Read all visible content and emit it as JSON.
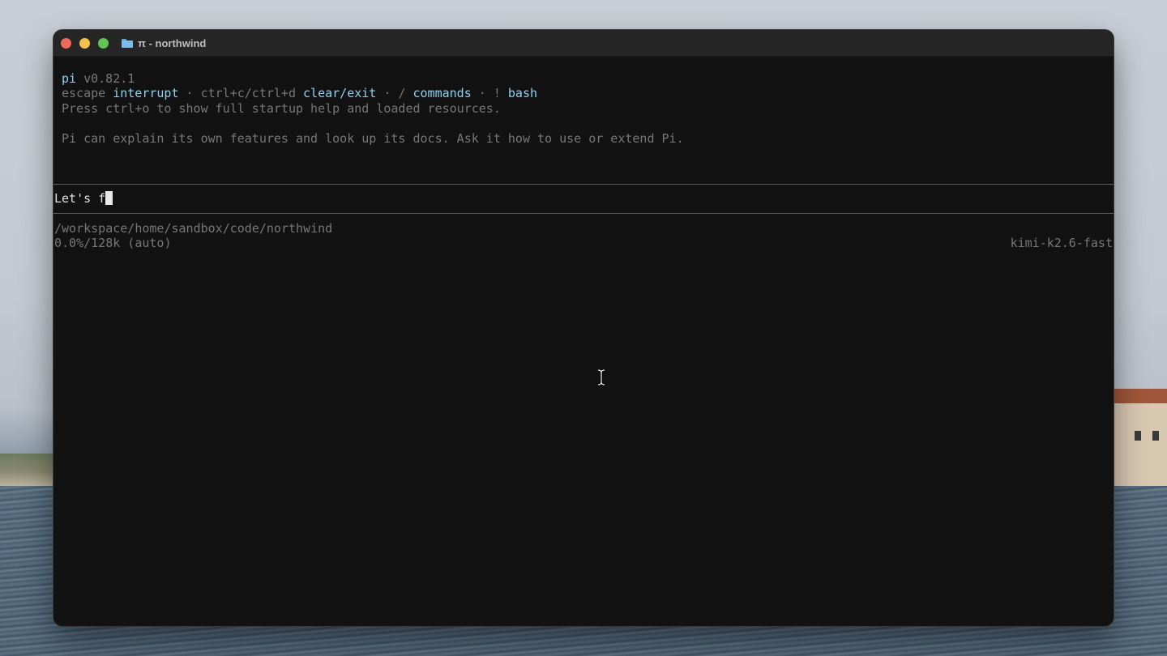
{
  "window": {
    "title": "π - northwind"
  },
  "terminal": {
    "app_name": "pi",
    "version": "v0.82.1",
    "hints": [
      {
        "key": "escape",
        "action": "interrupt"
      },
      {
        "key": "ctrl+c/ctrl+d",
        "action": "clear/exit"
      },
      {
        "key": "/",
        "action": "commands"
      },
      {
        "key": "!",
        "action": "bash"
      }
    ],
    "separator": " · ",
    "startup_hint": "Press ctrl+o to show full startup help and loaded resources.",
    "info_message": "Pi can explain its own features and look up its docs. Ask it how to use or extend Pi.",
    "input_value": "Let's f",
    "cwd": "/workspace/home/sandbox/code/northwind",
    "context_usage": "0.0%/128k (auto)",
    "model": "kimi-k2.6-fast"
  },
  "colors": {
    "accent": "#8fd0f0",
    "muted": "#777777",
    "terminal_bg": "#121212",
    "titlebar_bg": "#262626"
  },
  "icons": [
    "close-button",
    "minimize-button",
    "zoom-button",
    "folder-icon",
    "text-cursor-icon"
  ]
}
